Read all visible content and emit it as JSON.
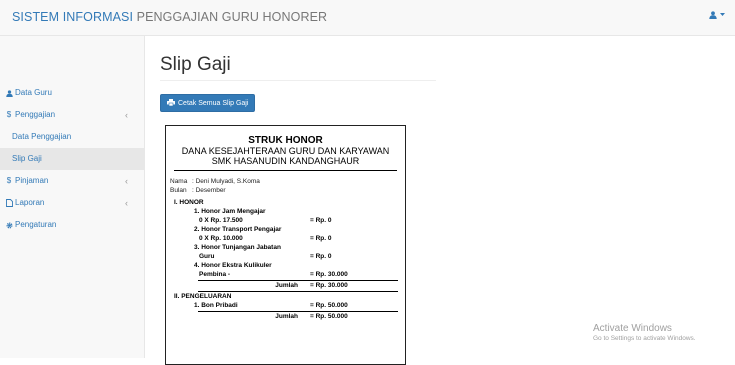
{
  "brand": {
    "part1": "SISTEM INFORMASI",
    "part2": " PENGGAJIAN GURU HONORER"
  },
  "user_menu": {
    "icon": "user-icon",
    "caret": "caret-down-icon"
  },
  "sidebar": {
    "items": [
      {
        "label": "Data Guru",
        "icon": "user-icon"
      },
      {
        "label": "Penggajian",
        "icon": "dollar-icon",
        "chevron": "‹"
      },
      {
        "label": "Data Penggajian"
      },
      {
        "label": "Slip Gaji"
      },
      {
        "label": "Pinjaman",
        "icon": "dollar-icon",
        "chevron": "‹"
      },
      {
        "label": "Laporan",
        "icon": "file-icon",
        "chevron": "‹"
      },
      {
        "label": "Pengaturan",
        "icon": "gear-icon"
      }
    ]
  },
  "page": {
    "title": "Slip Gaji",
    "print_button": "Cetak Semua Slip Gaji"
  },
  "slip": {
    "title": "STRUK HONOR",
    "subtitle1": "DANA KESEJAHTERAAN GURU DAN KARYAWAN",
    "subtitle2": "SMK HASANUDIN KANDANGHAUR",
    "nama_label": "Nama",
    "nama_value": ": Deni Mulyadi, S.Koma",
    "bulan_label": "Bulan",
    "bulan_value": ": Desember",
    "honor_header": "I. HONOR",
    "items": [
      {
        "l1": "1. Honor Jam Mengajar",
        "l2": "0 X Rp. 17.500",
        "val": "= Rp. 0"
      },
      {
        "l1": "2. Honor Transport Pengajar",
        "l2": "0 X Rp. 10.000",
        "val": "= Rp. 0"
      },
      {
        "l1": "3. Honor Tunjangan Jabatan",
        "l2": "Guru",
        "val": "= Rp. 0"
      },
      {
        "l1": "4. Honor Ekstra Kulikuler",
        "l2": "Pembina -",
        "val": "= Rp. 30.000"
      }
    ],
    "jumlah_label": "Jumlah",
    "jumlah_honor": "= Rp. 30.000",
    "pengeluaran_header": "II. PENGELUARAN",
    "pengeluaran_item": "1. Bon Pribadi",
    "pengeluaran_val": "= Rp. 50.000",
    "jumlah_pengeluaran": "= Rp. 50.000"
  },
  "watermark": {
    "line1": "Activate Windows",
    "line2": "Go to Settings to activate Windows."
  }
}
